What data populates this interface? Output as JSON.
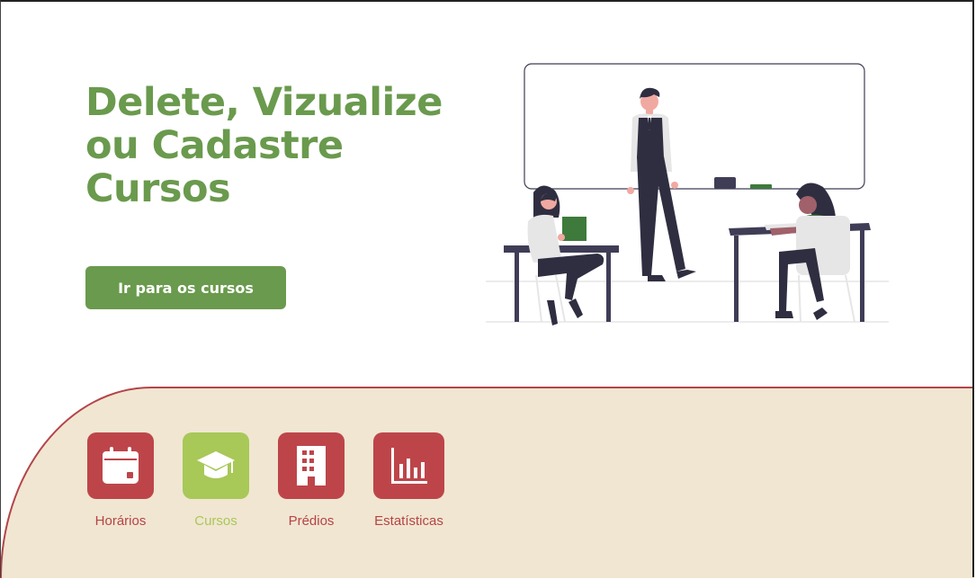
{
  "hero": {
    "title": "Delete, Vizualize ou Cadastre Cursos",
    "cta_label": "Ir para os cursos"
  },
  "nav": {
    "items": [
      {
        "label": "Horários",
        "icon": "calendar-icon",
        "active": false
      },
      {
        "label": "Cursos",
        "icon": "graduation-cap-icon",
        "active": true
      },
      {
        "label": "Prédios",
        "icon": "building-icon",
        "active": false
      },
      {
        "label": "Estatísticas",
        "icon": "bar-chart-icon",
        "active": false
      }
    ]
  },
  "colors": {
    "accent_green": "#6a9a4d",
    "active_green": "#a8c858",
    "nav_red": "#bd454a",
    "panel_beige": "#f1e6d1"
  }
}
